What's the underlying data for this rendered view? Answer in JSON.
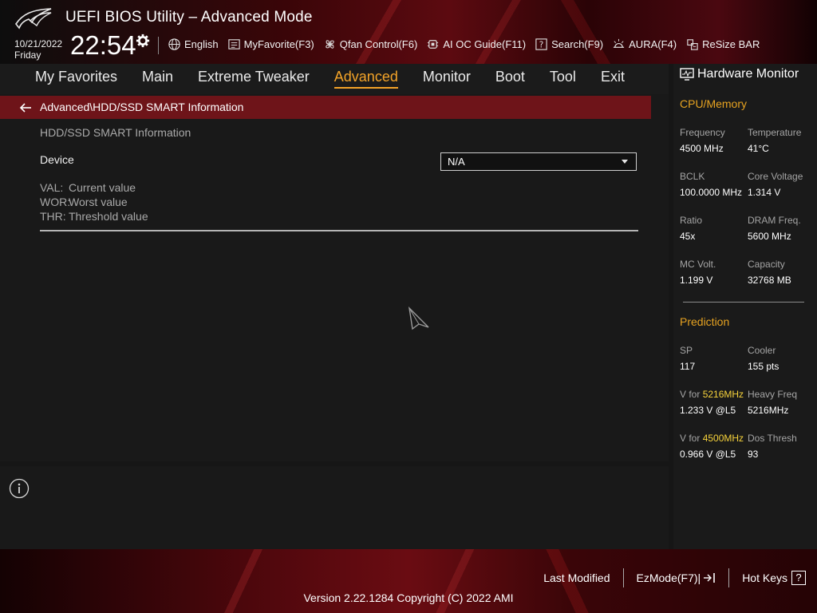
{
  "header": {
    "title": "UEFI BIOS Utility – Advanced Mode",
    "date": "10/21/2022",
    "day": "Friday",
    "time": "22:54"
  },
  "toolbar": {
    "items": [
      {
        "label": "English",
        "icon": "globe-icon"
      },
      {
        "label": "MyFavorite(F3)",
        "icon": "favorite-list-icon"
      },
      {
        "label": "Qfan Control(F6)",
        "icon": "fan-icon"
      },
      {
        "label": "AI OC Guide(F11)",
        "icon": "ai-chip-icon"
      },
      {
        "label": "Search(F9)",
        "icon": "search-help-icon"
      },
      {
        "label": "AURA(F4)",
        "icon": "aura-light-icon"
      },
      {
        "label": "ReSize BAR",
        "icon": "resize-bar-icon"
      }
    ]
  },
  "nav": {
    "tabs": [
      {
        "label": "My Favorites",
        "active": false
      },
      {
        "label": "Main",
        "active": false
      },
      {
        "label": "Extreme Tweaker",
        "active": false
      },
      {
        "label": "Advanced",
        "active": true
      },
      {
        "label": "Monitor",
        "active": false
      },
      {
        "label": "Boot",
        "active": false
      },
      {
        "label": "Tool",
        "active": false
      },
      {
        "label": "Exit",
        "active": false
      }
    ]
  },
  "main": {
    "breadcrumb": "Advanced\\HDD/SSD SMART Information",
    "section_title": "HDD/SSD SMART Information",
    "device_label": "Device",
    "device_value": "N/A",
    "legend": [
      {
        "key": "VAL:",
        "desc": "Current value"
      },
      {
        "key": "WOR:",
        "desc": "Worst value"
      },
      {
        "key": "THR:",
        "desc": "Threshold value"
      }
    ]
  },
  "hw_monitor": {
    "title": "Hardware Monitor",
    "cpu_section": "CPU/Memory",
    "cpu": {
      "frequency_label": "Frequency",
      "frequency": "4500 MHz",
      "temperature_label": "Temperature",
      "temperature": "41°C",
      "bclk_label": "BCLK",
      "bclk": "100.0000 MHz",
      "core_voltage_label": "Core Voltage",
      "core_voltage": "1.314 V",
      "ratio_label": "Ratio",
      "ratio": "45x",
      "dram_freq_label": "DRAM Freq.",
      "dram_freq": "5600 MHz",
      "mc_volt_label": "MC Volt.",
      "mc_volt": "1.199 V",
      "capacity_label": "Capacity",
      "capacity": "32768 MB"
    },
    "prediction_section": "Prediction",
    "prediction": {
      "sp_label": "SP",
      "sp": "117",
      "cooler_label": "Cooler",
      "cooler": "155 pts",
      "v_for_1_prefix": "V for ",
      "v_for_1_freq": "5216MHz",
      "v_for_1_value": "1.233 V @L5",
      "heavy_freq_label": "Heavy Freq",
      "heavy_freq": "5216MHz",
      "v_for_2_prefix": "V for ",
      "v_for_2_freq": "4500MHz",
      "v_for_2_value": "0.966 V @L5",
      "dos_thresh_label": "Dos Thresh",
      "dos_thresh": "93"
    }
  },
  "footer": {
    "last_modified": "Last Modified",
    "ezmode": "EzMode(F7)|",
    "hot_keys": "Hot Keys",
    "hot_keys_key": "?",
    "version": "Version 2.22.1284 Copyright (C) 2022 AMI"
  },
  "colors": {
    "accent_orange": "#f3a328",
    "highlight_yellow": "#f6d23b",
    "breadcrumb_red": "#6e1419"
  }
}
